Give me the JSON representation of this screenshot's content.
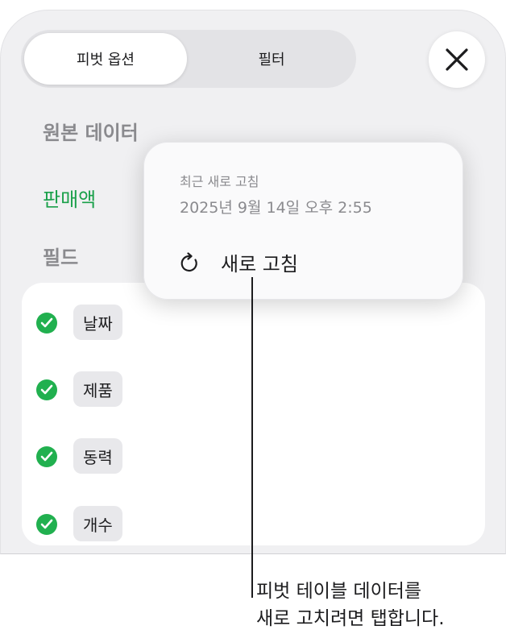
{
  "tabs": {
    "pivot_options_label": "피벗 옵션",
    "filter_label": "필터"
  },
  "close": {
    "icon": "close-icon"
  },
  "source_data": {
    "heading": "원본 데이터",
    "value": "판매액"
  },
  "fields": {
    "heading": "필드",
    "items": [
      {
        "label": "날짜"
      },
      {
        "label": "제품"
      },
      {
        "label": "동력"
      },
      {
        "label": "개수"
      }
    ]
  },
  "popover": {
    "last_refresh_label": "최근 새로 고침",
    "last_refresh_time": "2025년 9월 14일 오후 2:55",
    "refresh_button_label": "새로 고침",
    "refresh_icon": "refresh-icon"
  },
  "callout": {
    "line1": "피벗 테이블 데이터를",
    "line2": "새로 고치려면 탭합니다."
  },
  "colors": {
    "accent_green": "#1aa04a",
    "check_green": "#21b04f"
  }
}
